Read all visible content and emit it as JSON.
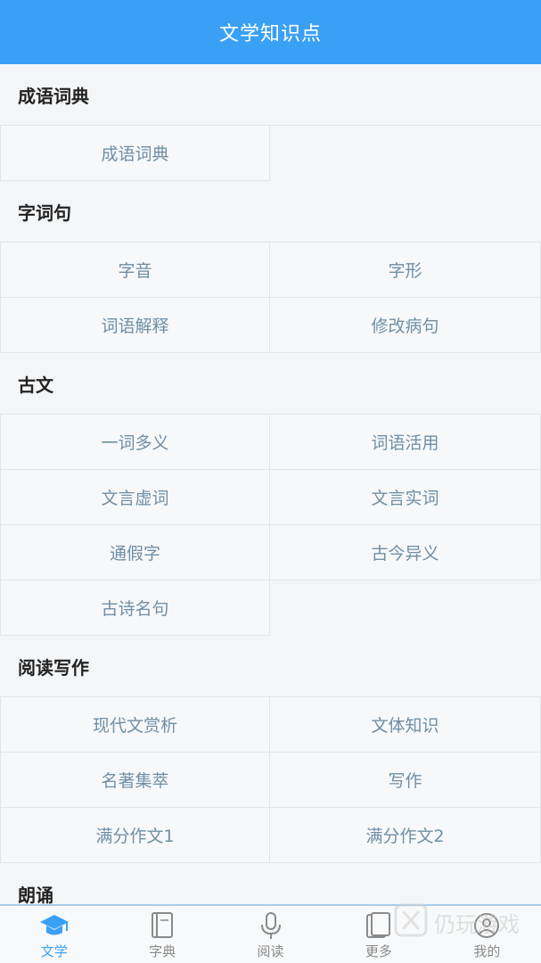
{
  "header": {
    "title": "文学知识点"
  },
  "sections": [
    {
      "title": "成语词典",
      "items": [
        "成语词典"
      ]
    },
    {
      "title": "字词句",
      "items": [
        "字音",
        "字形",
        "词语解释",
        "修改病句"
      ]
    },
    {
      "title": "古文",
      "items": [
        "一词多义",
        "词语活用",
        "文言虚词",
        "文言实词",
        "通假字",
        "古今异义",
        "古诗名句"
      ]
    },
    {
      "title": "阅读写作",
      "items": [
        "现代文赏析",
        "文体知识",
        "名著集萃",
        "写作",
        "满分作文1",
        "满分作文2"
      ]
    },
    {
      "title": "朗诵",
      "items": []
    }
  ],
  "tabs": [
    {
      "label": "文学",
      "icon": "graduation-cap-icon",
      "active": true
    },
    {
      "label": "字典",
      "icon": "book-icon",
      "active": false
    },
    {
      "label": "阅读",
      "icon": "microphone-icon",
      "active": false
    },
    {
      "label": "更多",
      "icon": "books-icon",
      "active": false
    },
    {
      "label": "我的",
      "icon": "user-circle-icon",
      "active": false
    }
  ],
  "watermark": {
    "text": "仍玩游戏"
  },
  "colors": {
    "primary": "#3aa0f5",
    "item_text": "#6f8fa5",
    "inactive_tab": "#8a8a8a"
  }
}
